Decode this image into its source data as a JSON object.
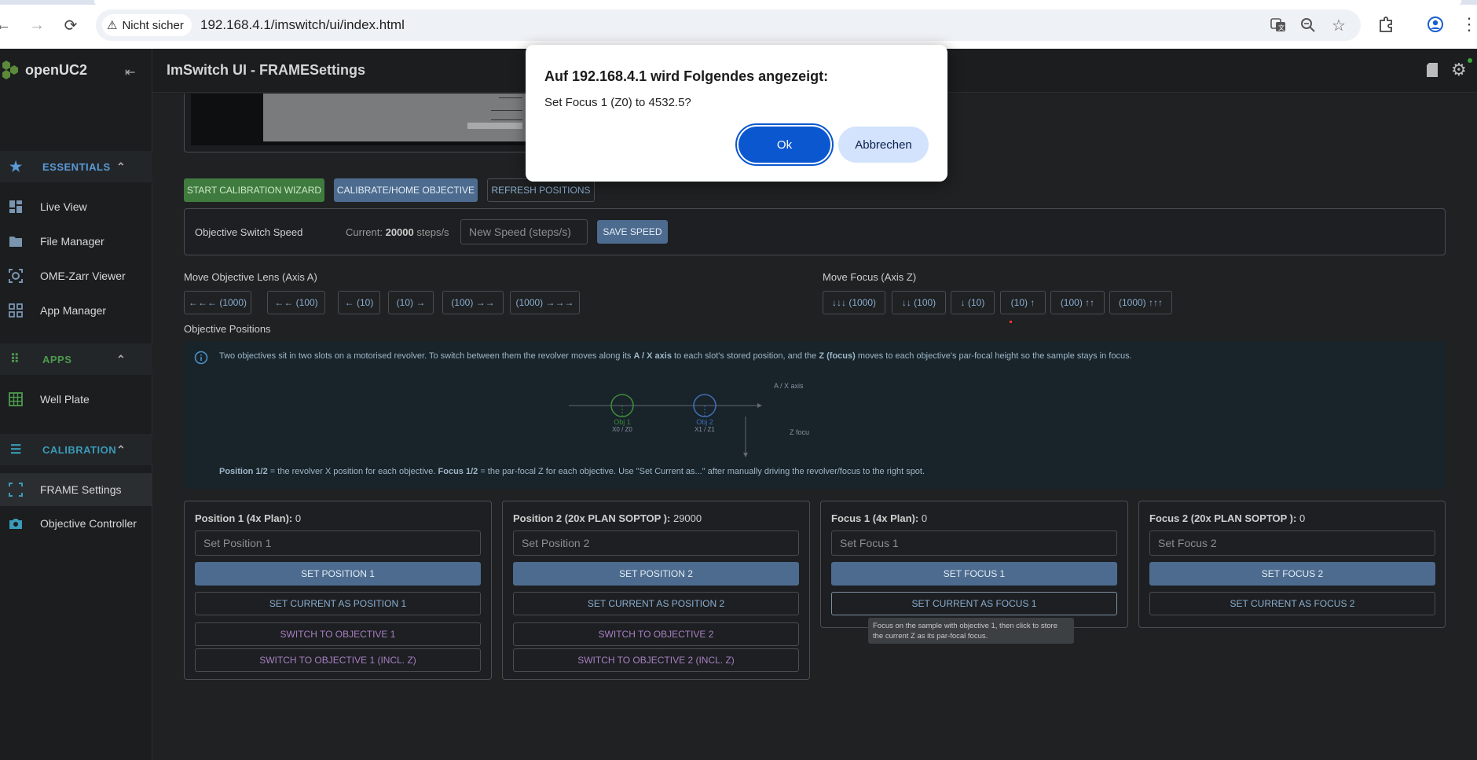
{
  "browser": {
    "security_label": "Nicht sicher",
    "url": "192.168.4.1/imswitch/ui/index.html"
  },
  "sidebar": {
    "logo_text": "openUC2",
    "sections": [
      {
        "label": "ESSENTIALS",
        "color": "#5a9ad8"
      },
      {
        "label": "APPS",
        "color": "#4d9a4d"
      },
      {
        "label": "CALIBRATION",
        "color": "#3a9ab8"
      }
    ],
    "items": [
      {
        "label": "Live View",
        "icon": "dashboard-icon"
      },
      {
        "label": "File Manager",
        "icon": "folder-icon"
      },
      {
        "label": "OME-Zarr Viewer",
        "icon": "zarr-viewer-icon"
      },
      {
        "label": "App Manager",
        "icon": "apps-grid-icon"
      },
      {
        "label": "Well Plate",
        "icon": "well-plate-icon"
      },
      {
        "label": "FRAME Settings",
        "icon": "frame-icon"
      },
      {
        "label": "Objective Controller",
        "icon": "camera-icon"
      }
    ]
  },
  "appbar": {
    "title": "ImSwitch UI - FRAMESettings"
  },
  "toolbar": {
    "start_wizard": "START CALIBRATION WIZARD",
    "calibrate_home": "CALIBRATE/HOME OBJECTIVE",
    "refresh_positions": "REFRESH POSITIONS"
  },
  "speed": {
    "label": "Objective Switch Speed",
    "current_prefix": "Current:",
    "current_value": "20000",
    "current_unit": "steps/s",
    "placeholder": "New Speed (steps/s)",
    "save": "SAVE SPEED"
  },
  "move_objective": {
    "label": "Move Objective Lens (Axis A)",
    "buttons": [
      "←←← (1000)",
      "←← (100)",
      "← (10)",
      "(10) →",
      "(100) →→",
      "(1000) →→→"
    ]
  },
  "move_focus": {
    "label": "Move Focus (Axis Z)",
    "buttons": [
      "↓↓↓ (1000)",
      "↓↓ (100)",
      "↓ (10)",
      "(10) ↑",
      "(100) ↑↑",
      "(1000) ↑↑↑"
    ]
  },
  "positions_title": "Objective Positions",
  "info": {
    "text_a": "Two objectives sit in two slots on a motorised revolver. To switch between them the revolver moves along its ",
    "bold_a": "A / X axis",
    "text_b": " to each slot's stored position, and the ",
    "bold_b": "Z (focus)",
    "text_c": " moves to each objective's par-focal height so the sample stays in focus.",
    "diagram": {
      "axis_label": "A / X axis",
      "z_label": "Z focu",
      "obj1": "Obj 1",
      "obj1_sub": "X0 / Z0",
      "obj2": "Obj 2",
      "obj2_sub": "X1 / Z1"
    },
    "foot_bold_a": "Position 1/2",
    "foot_a": " = the revolver X position for each objective. ",
    "foot_bold_b": "Focus 1/2",
    "foot_b": " = the par-focal Z for each objective. Use \"Set Current as...\" after manually driving the revolver/focus to the right spot."
  },
  "cards": [
    {
      "title": "Position 1 (4x Plan):",
      "value": "0",
      "placeholder": "Set Position 1",
      "set": "SET POSITION 1",
      "current": "SET CURRENT AS POSITION 1",
      "switch": "SWITCH TO OBJECTIVE 1",
      "switch_z": "SWITCH TO OBJECTIVE 1 (INCL. Z)"
    },
    {
      "title": "Position 2 (20x PLAN SOPTOP ):",
      "value": "29000",
      "placeholder": "Set Position 2",
      "set": "SET POSITION 2",
      "current": "SET CURRENT AS POSITION 2",
      "switch": "SWITCH TO OBJECTIVE 2",
      "switch_z": "SWITCH TO OBJECTIVE 2 (INCL. Z)"
    },
    {
      "title": "Focus 1 (4x Plan):",
      "value": "0",
      "placeholder": "Set Focus 1",
      "set": "SET FOCUS 1",
      "current": "SET CURRENT AS FOCUS 1"
    },
    {
      "title": "Focus 2 (20x PLAN SOPTOP ):",
      "value": "0",
      "placeholder": "Set Focus 2",
      "set": "SET FOCUS 2",
      "current": "SET CURRENT AS FOCUS 2"
    }
  ],
  "tooltip": "Focus on the sample with objective 1, then click to store the current Z as its par-focal focus.",
  "dialog": {
    "heading": "Auf 192.168.4.1 wird Folgendes angezeigt:",
    "message": "Set Focus 1 (Z0) to 4532.5?",
    "ok": "Ok",
    "cancel": "Abbrechen"
  }
}
